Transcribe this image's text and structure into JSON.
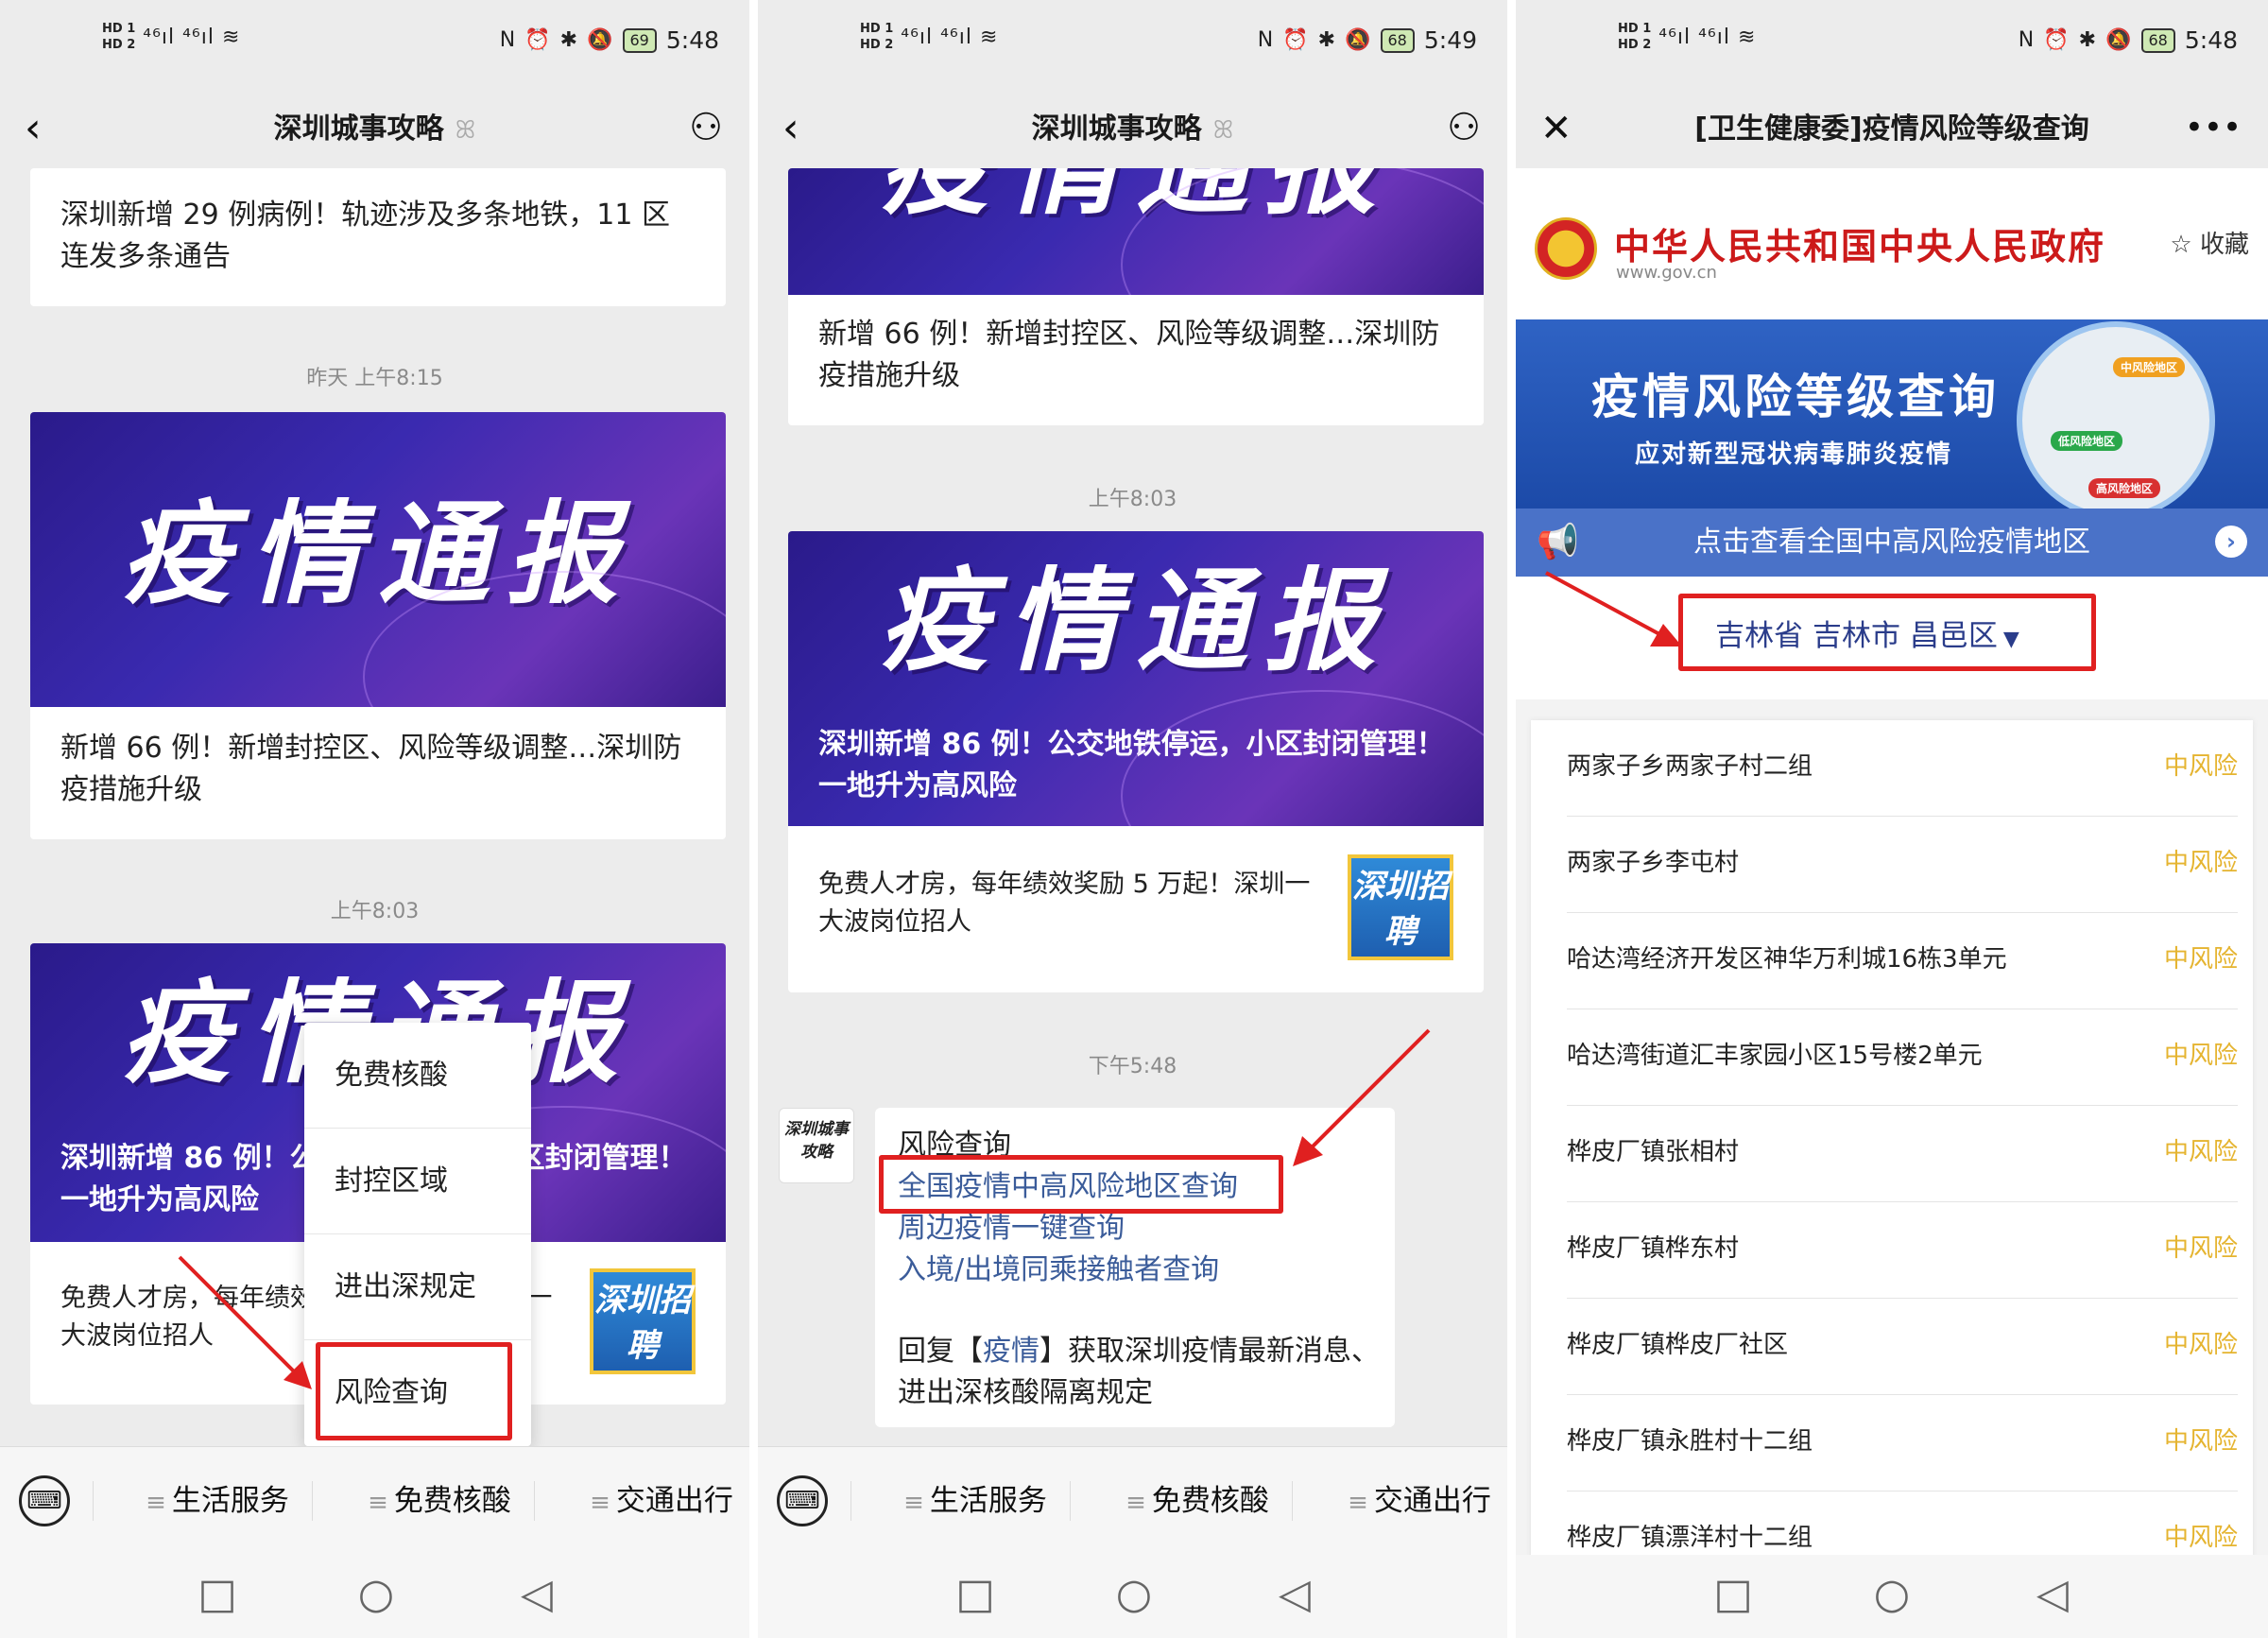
{
  "status": {
    "hd1": "HD 1",
    "hd2": "HD 2",
    "signal": "⁴⁶ıl ⁴⁶ıl",
    "wifi": "≋",
    "nfc": "N",
    "alarm": "⏰",
    "bt": "✱",
    "mute": "🔕"
  },
  "panel1": {
    "clock": "5:48",
    "battery": "69",
    "nav_title": "深圳城事攻略",
    "nav_sub": "ꕤ",
    "card1_title": "深圳新增 29 例病例！轨迹涉及多条地铁，11 区连发多条通告",
    "time1": "昨天 上午8:15",
    "banner1": "疫情通报",
    "card2_title": "新增 66 例！新增封控区、风险等级调整…深圳防疫措施升级",
    "time2": "上午8:03",
    "banner2": "疫情通报",
    "card3_caption": "深圳新增 86 例！公交地铁停运，小区封闭管理！一地升为高风险",
    "card3_sub": "免费人才房，每年绩效奖励 5 万起！深圳一大波岗位招人",
    "thumb": "深圳招聘",
    "popup": [
      "免费核酸",
      "封控区域",
      "进出深规定",
      "风险查询"
    ],
    "menu": [
      "生活服务",
      "免费核酸",
      "交通出行"
    ]
  },
  "panel2": {
    "clock": "5:49",
    "battery": "68",
    "nav_title": "深圳城事攻略",
    "nav_sub": "ꕤ",
    "banner0": "疫情通报",
    "card1_title": "新增 66 例！新增封控区、风险等级调整…深圳防疫措施升级",
    "time1": "上午8:03",
    "banner1": "疫情通报",
    "card2_caption": "深圳新增 86 例！公交地铁停运，小区封闭管理！一地升为高风险",
    "card2_sub": "免费人才房，每年绩效奖励 5 万起！深圳一大波岗位招人",
    "thumb": "深圳招聘",
    "time2": "下午5:48",
    "avatar": "深圳城事攻略",
    "bubble": {
      "line1": "风险查询",
      "link1": "全国疫情中高风险地区查询",
      "link2": "周边疫情一键查询",
      "link3": "入境/出境同乘接触者查询",
      "reply_a": "回复【",
      "reply_kw": "疫情",
      "reply_b": "】获取深圳疫情最新消息、进出深核酸隔离规定"
    },
    "menu": [
      "生活服务",
      "免费核酸",
      "交通出行"
    ]
  },
  "panel3": {
    "clock": "5:48",
    "battery": "68",
    "nav_title": "[卫生健康委]疫情风险等级查询",
    "gov_name": "中华人民共和国中央人民政府",
    "gov_url": "www.gov.cn",
    "fav": "☆ 收藏",
    "hero_title": "疫情风险等级查询",
    "hero_sub": "应对新型冠状病毒肺炎疫情",
    "tag_mid": "中风险地区",
    "tag_low": "低风险地区",
    "tag_high": "高风险地区",
    "strip": "点击查看全国中高风险疫情地区",
    "region": "吉林省 吉林市 昌邑区",
    "rows": [
      {
        "name": "两家子乡两家子村二组",
        "level": "中风险"
      },
      {
        "name": "两家子乡李屯村",
        "level": "中风险"
      },
      {
        "name": "哈达湾经济开发区神华万利城16栋3单元",
        "level": "中风险"
      },
      {
        "name": "哈达湾街道汇丰家园小区15号楼2单元",
        "level": "中风险"
      },
      {
        "name": "桦皮厂镇张相村",
        "level": "中风险"
      },
      {
        "name": "桦皮厂镇桦东村",
        "level": "中风险"
      },
      {
        "name": "桦皮厂镇桦皮厂社区",
        "level": "中风险"
      },
      {
        "name": "桦皮厂镇永胜村十二组",
        "level": "中风险"
      },
      {
        "name": "桦皮厂镇漂洋村十二组",
        "level": "中风险"
      }
    ]
  },
  "colors": {
    "accent_red": "#e02020",
    "gov_red": "#cc1a1a",
    "risk_mid": "#e5b430",
    "link": "#3b5c9a"
  }
}
